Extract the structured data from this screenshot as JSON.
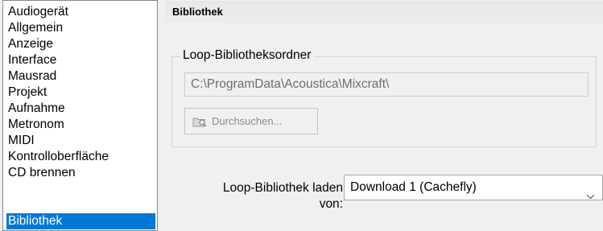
{
  "sidebar": {
    "items": [
      {
        "label": "Audiogerät"
      },
      {
        "label": "Allgemein"
      },
      {
        "label": "Anzeige"
      },
      {
        "label": "Interface"
      },
      {
        "label": "Mausrad"
      },
      {
        "label": "Projekt"
      },
      {
        "label": "Aufnahme"
      },
      {
        "label": "Metronom"
      },
      {
        "label": "MIDI"
      },
      {
        "label": "Kontrolloberfläche"
      },
      {
        "label": "CD brennen"
      },
      {
        "label": "Bibliothek"
      }
    ],
    "selected": "Bibliothek"
  },
  "section": {
    "title": "Bibliothek"
  },
  "loop_folder": {
    "group_title": "Loop-Bibliotheksordner",
    "path_value": "C:\\ProgramData\\Acoustica\\Mixcraft\\",
    "browse_label": "Durchsuchen..."
  },
  "load_from": {
    "label_line1": "Loop-Bibliothek laden",
    "label_line2": "von:",
    "selected_value": "Download 1 (Cachefly)"
  },
  "colors": {
    "selection": "#0078d7",
    "panel_bg": "#f0f0f0",
    "disabled_text": "#6d6d6d"
  },
  "icons": {
    "browse": "folder-search-icon",
    "dropdown": "chevron-down-icon"
  }
}
